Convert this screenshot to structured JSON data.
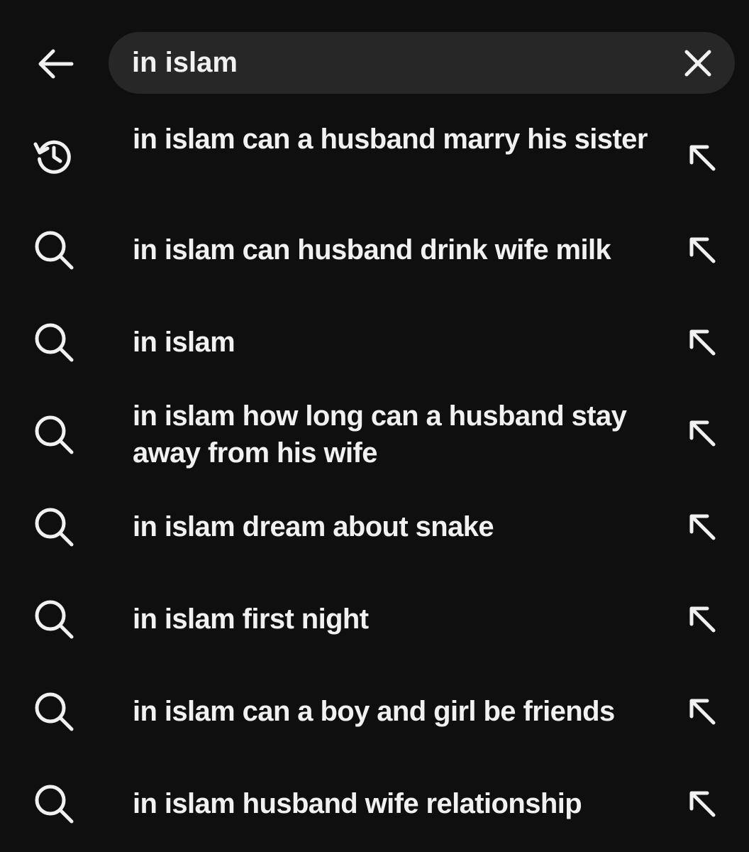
{
  "search": {
    "value": "in islam"
  },
  "suggestions": [
    {
      "icon": "history-icon",
      "text": "in islam can a husband marry his sister"
    },
    {
      "icon": "search-icon",
      "text": "in islam can husband drink wife milk"
    },
    {
      "icon": "search-icon",
      "text": "in islam"
    },
    {
      "icon": "search-icon",
      "text": "in islam how long can a husband stay away from his wife"
    },
    {
      "icon": "search-icon",
      "text": "in islam dream about snake"
    },
    {
      "icon": "search-icon",
      "text": "in islam first night"
    },
    {
      "icon": "search-icon",
      "text": "in islam can a boy and girl be friends"
    },
    {
      "icon": "search-icon",
      "text": "in islam husband wife relationship"
    }
  ],
  "colors": {
    "background": "#0f0f0f",
    "search_box": "#272727",
    "text": "#f1f1f1"
  }
}
